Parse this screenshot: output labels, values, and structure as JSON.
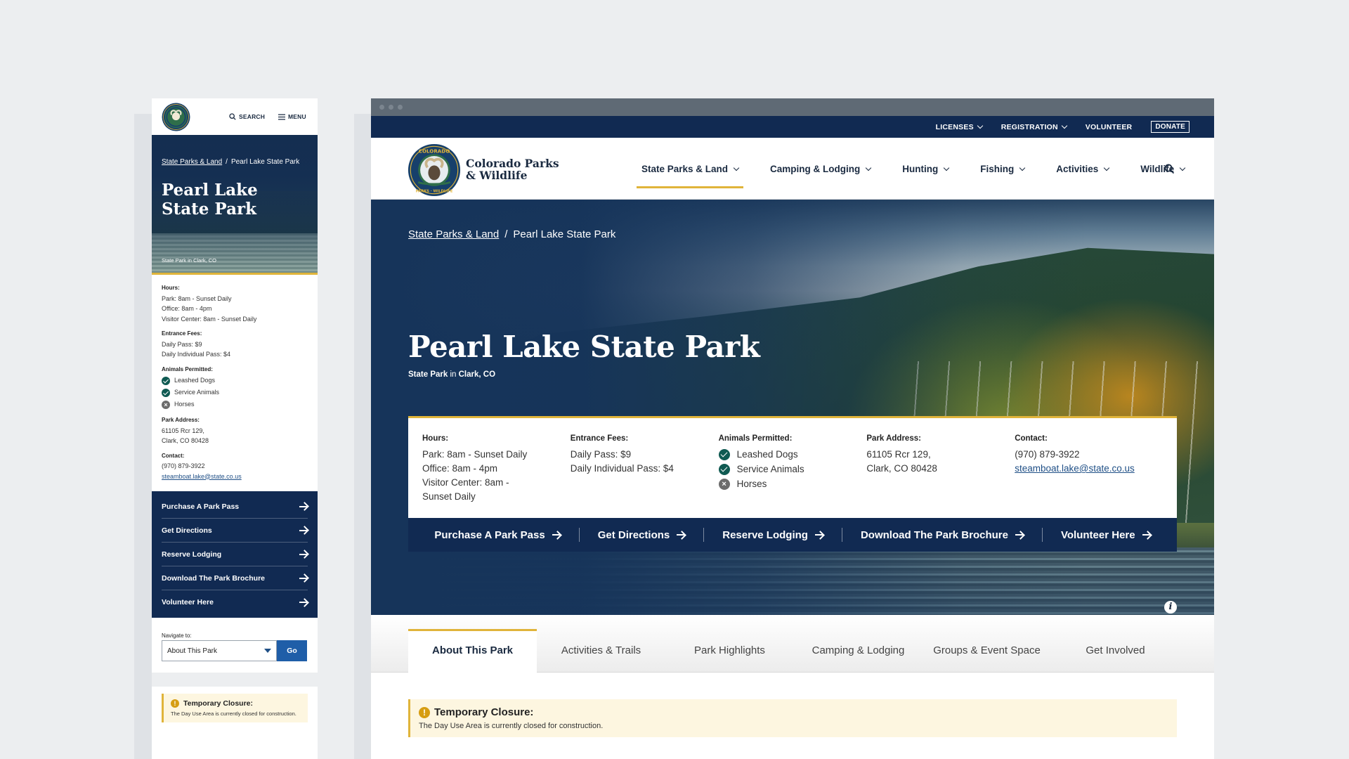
{
  "brand": {
    "name_line1": "Colorado Parks",
    "name_line2": "& Wildlife",
    "logo_top": "COLORADO",
    "logo_bottom": "PARKS · WILDLIFE"
  },
  "colors": {
    "navy": "#112a52",
    "gold": "#e0b43a",
    "link": "#1f4f86",
    "go_button": "#1f5ea8"
  },
  "utility_nav": [
    "LICENSES",
    "REGISTRATION",
    "VOLUNTEER"
  ],
  "utility_donate": "DONATE",
  "main_nav": [
    "State Parks & Land",
    "Camping & Lodging",
    "Hunting",
    "Fishing",
    "Activities",
    "Wildlife"
  ],
  "mobile_header": {
    "search": "SEARCH",
    "menu": "MENU"
  },
  "breadcrumb": {
    "parent": "State Parks & Land",
    "separator": "/",
    "current": "Pearl Lake State Park"
  },
  "park": {
    "title": "Pearl Lake State Park",
    "subtitle_type": "State Park",
    "subtitle_in": "in",
    "subtitle_place": "Clark, CO"
  },
  "facts": {
    "hours_label": "Hours:",
    "hours": [
      "Park: 8am - Sunset Daily",
      "Office: 8am - 4pm",
      "Visitor Center: 8am - Sunset Daily"
    ],
    "fees_label": "Entrance Fees:",
    "fees": [
      "Daily Pass: $9",
      "Daily Individual Pass: $4"
    ],
    "animals_label": "Animals Permitted:",
    "animals": [
      {
        "name": "Leashed Dogs",
        "allowed": true
      },
      {
        "name": "Service Animals",
        "allowed": true
      },
      {
        "name": "Horses",
        "allowed": false
      }
    ],
    "address_label": "Park Address:",
    "address": [
      "61105 Rcr 129,",
      "Clark, CO 80428"
    ],
    "contact_label": "Contact:",
    "phone": "(970) 879-3922",
    "email": "steamboat.lake@state.co.us"
  },
  "actions": [
    "Purchase A Park Pass",
    "Get Directions",
    "Reserve Lodging",
    "Download The Park Brochure",
    "Volunteer Here"
  ],
  "tabs": [
    "About This Park",
    "Activities & Trails",
    "Park Highlights",
    "Camping & Lodging",
    "Groups & Event Space",
    "Get Involved"
  ],
  "mobile_navigate": {
    "label": "Navigate to:",
    "selected": "About This Park",
    "go": "Go"
  },
  "alert": {
    "title": "Temporary Closure:",
    "text": "The Day Use Area is currently closed for construction."
  },
  "info_glyph": "i",
  "icons": {
    "search": "search-icon",
    "menu": "hamburger-icon",
    "arrow": "arrow-right-icon",
    "chevron": "chevron-down-icon"
  }
}
